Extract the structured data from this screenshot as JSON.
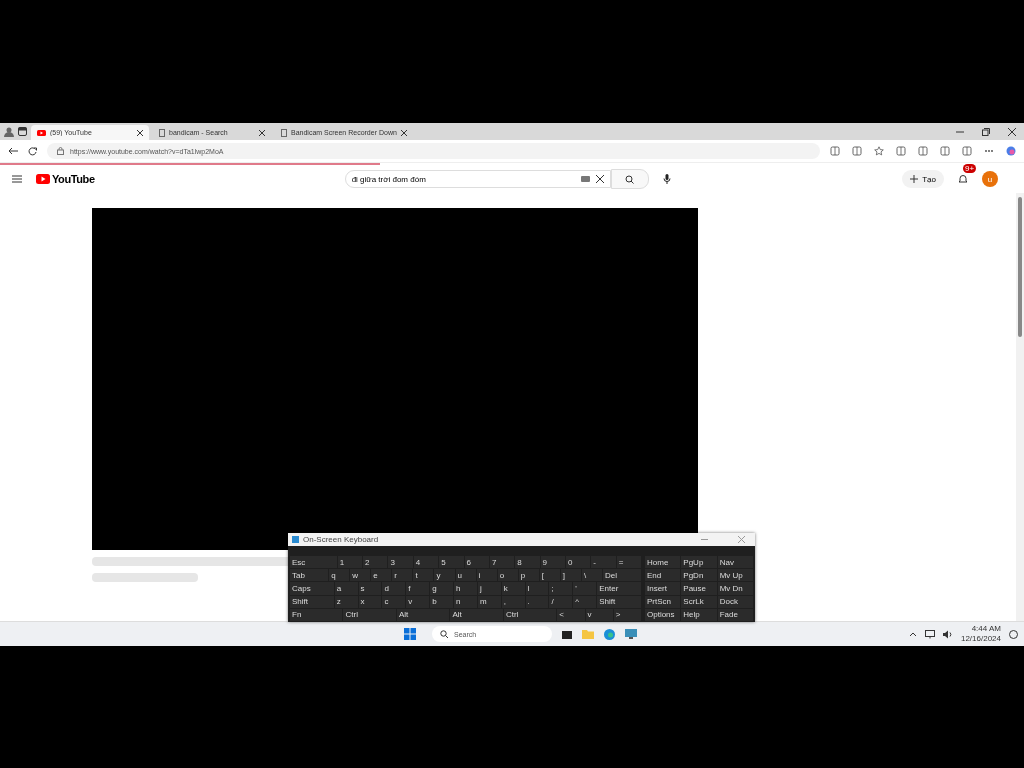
{
  "browser": {
    "tabs": [
      {
        "label": "(59) YouTube",
        "selected": true
      },
      {
        "label": "bandicam - Search",
        "selected": false
      },
      {
        "label": "Bandicam Screen Recorder Down",
        "selected": false
      }
    ],
    "address": "https://www.youtube.com/watch?v=dTa1lwp2MoA"
  },
  "youtube": {
    "logo": "YouTube",
    "search": "đi giữa trời đom đóm",
    "create_button": "Tạo",
    "notification_count": "9+",
    "avatar": "u"
  },
  "keyboard": {
    "title": "On-Screen Keyboard",
    "rows": [
      [
        "Esc",
        "1",
        "2",
        "3",
        "4",
        "5",
        "6",
        "7",
        "8",
        "9",
        "0",
        "-",
        "="
      ],
      [
        "Tab",
        "q",
        "w",
        "e",
        "r",
        "t",
        "y",
        "u",
        "i",
        "o",
        "p",
        "[",
        "]",
        "\\",
        "Del"
      ],
      [
        "Caps",
        "a",
        "s",
        "d",
        "f",
        "g",
        "h",
        "j",
        "k",
        "l",
        ";",
        "'",
        "Enter"
      ],
      [
        "Shift",
        "z",
        "x",
        "c",
        "v",
        "b",
        "n",
        "m",
        ",",
        ".",
        "/",
        "^",
        "Shift"
      ],
      [
        "Fn",
        "Ctrl",
        "Alt",
        "Alt",
        "Ctrl",
        "<",
        "v",
        ">"
      ]
    ],
    "nav_keys": [
      [
        "Home",
        "PgUp",
        "Nav"
      ],
      [
        "End",
        "PgDn",
        "Mv Up"
      ],
      [
        "Insert",
        "Pause",
        "Mv Dn"
      ],
      [
        "PrtScn",
        "ScrLk",
        "Dock"
      ],
      [
        "Options",
        "Help",
        "Fade"
      ]
    ]
  },
  "taskbar": {
    "search": "Search",
    "time": "4:44 AM",
    "date": "12/16/2024"
  }
}
